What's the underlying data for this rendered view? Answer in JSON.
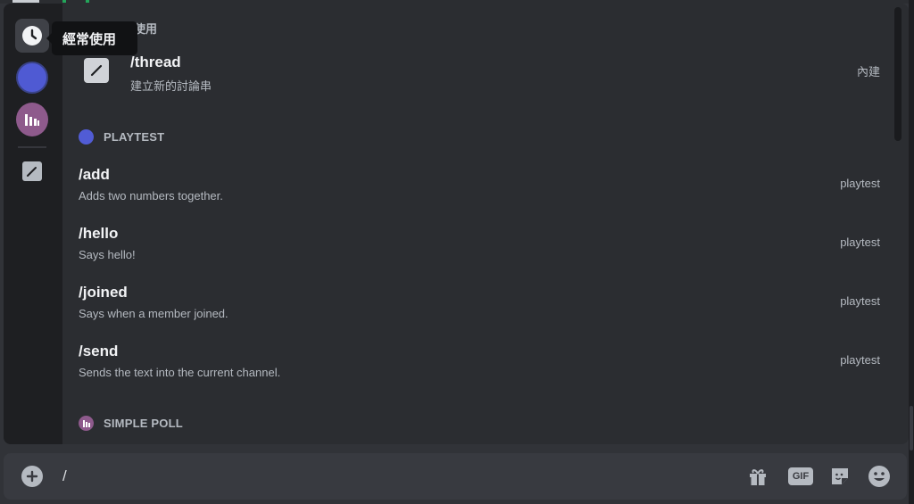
{
  "tooltip": {
    "text": "經常使用"
  },
  "frequent": {
    "header_fragment": "使用",
    "thread": {
      "name": "/thread",
      "description": "建立新的討論串",
      "source": "內建"
    }
  },
  "sections": {
    "playtest": {
      "title": "PLAYTEST",
      "color": "#5865f2"
    },
    "simple_poll": {
      "title": "SIMPLE POLL",
      "color": "#8e5a8c"
    }
  },
  "commands": [
    {
      "name": "/add",
      "description": "Adds two numbers together.",
      "source": "playtest"
    },
    {
      "name": "/hello",
      "description": "Says hello!",
      "source": "playtest"
    },
    {
      "name": "/joined",
      "description": "Says when a member joined.",
      "source": "playtest"
    },
    {
      "name": "/send",
      "description": "Sends the text into the current channel.",
      "source": "playtest"
    }
  ],
  "composer": {
    "value": "/",
    "gif_label": "GIF"
  },
  "icons": {
    "rail": [
      "clock-icon",
      "playtest-guild-icon",
      "poll-guild-icon",
      "pencil-icon"
    ],
    "composer": [
      "plus-icon",
      "gift-icon",
      "gif-icon",
      "sticker-icon",
      "emoji-icon"
    ]
  }
}
